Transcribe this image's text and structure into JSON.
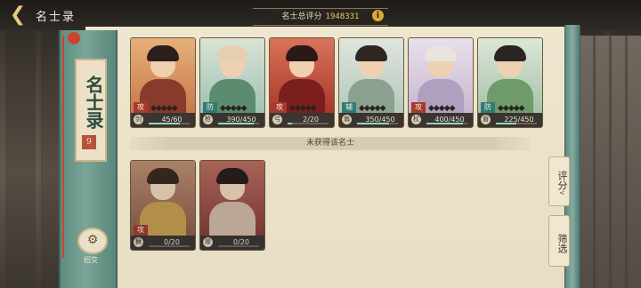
{
  "header": {
    "back_icon": "back-arrow-icon",
    "title": "名士录",
    "score_label": "名士总评分",
    "score_value": "1948331",
    "info_icon": "i"
  },
  "banner": {
    "title": "名士录",
    "mark": "9",
    "exchange_label": "招交"
  },
  "owned_cards": [
    {
      "count": "45/60",
      "role": "攻",
      "progress": 0.75,
      "type": "剑",
      "stars": "◆◆◆◆◆"
    },
    {
      "count": "390/450",
      "role": "防",
      "progress": 0.87,
      "type": "枪",
      "stars": "◆◆◆◆◆"
    },
    {
      "count": "2/20",
      "role": "攻",
      "progress": 0.1,
      "type": "弓",
      "stars": "◆◆◆◆◆"
    },
    {
      "count": "350/450",
      "role": "辅",
      "progress": 0.78,
      "type": "扇",
      "stars": "◆◆◆◆◆"
    },
    {
      "count": "400/450",
      "role": "攻",
      "progress": 0.89,
      "type": "杖",
      "stars": "◆◆◆◆◆"
    },
    {
      "count": "225/450",
      "role": "防",
      "progress": 0.5,
      "type": "盾",
      "stars": "◆◆◆◆◆"
    }
  ],
  "divider_label": "未获得该名士",
  "unowned_cards": [
    {
      "count": "0/20",
      "role": "攻",
      "progress": 0,
      "type": "舞"
    },
    {
      "count": "0/20",
      "role": "",
      "progress": 0,
      "type": "琴"
    }
  ],
  "side": {
    "rating_label": "评分",
    "filter_label": "筛选"
  },
  "colors": {
    "accent_gold": "#f0c75a",
    "banner_green": "#7aa598",
    "panel_paper": "#efe6cf",
    "role_red": "#a63a2c",
    "role_teal": "#2f7c76"
  }
}
